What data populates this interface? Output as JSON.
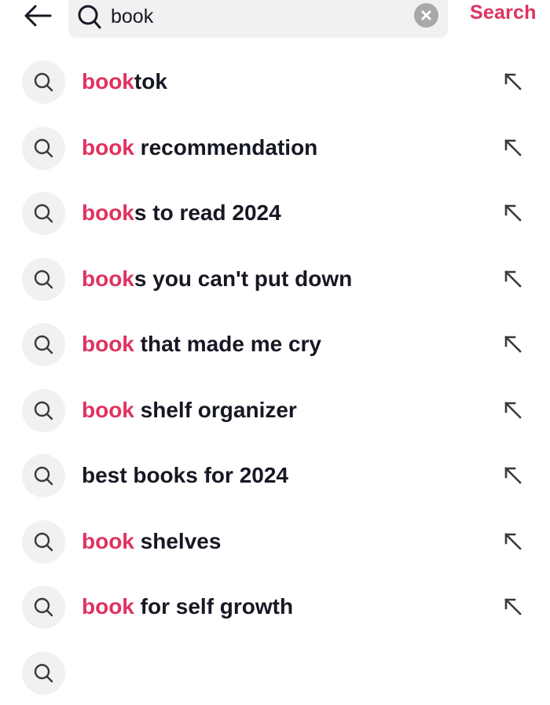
{
  "header": {
    "back_icon": "arrow-left-icon",
    "search_icon": "search-icon",
    "query": "book",
    "clear_icon": "clear-x-icon",
    "search_button_label": "Search"
  },
  "colors": {
    "accent": "#e0325f",
    "text": "#161823",
    "chip_bg": "#f1f1f2",
    "clear_bg": "#a8a8aa"
  },
  "suggestions": [
    {
      "highlight": "book",
      "rest": "tok",
      "icon": "search-icon",
      "action_icon": "fill-query-arrow-icon"
    },
    {
      "highlight": "book",
      "rest": " recommendation",
      "icon": "search-icon",
      "action_icon": "fill-query-arrow-icon"
    },
    {
      "highlight": "book",
      "rest": "s to read 2024",
      "icon": "search-icon",
      "action_icon": "fill-query-arrow-icon"
    },
    {
      "highlight": "book",
      "rest": "s you can't put down",
      "icon": "search-icon",
      "action_icon": "fill-query-arrow-icon"
    },
    {
      "highlight": "book",
      "rest": " that made me cry",
      "icon": "search-icon",
      "action_icon": "fill-query-arrow-icon"
    },
    {
      "highlight": "book",
      "rest": " shelf organizer",
      "icon": "search-icon",
      "action_icon": "fill-query-arrow-icon"
    },
    {
      "highlight": "",
      "rest": "best books for 2024",
      "icon": "search-icon",
      "action_icon": "fill-query-arrow-icon"
    },
    {
      "highlight": "book",
      "rest": " shelves",
      "icon": "search-icon",
      "action_icon": "fill-query-arrow-icon"
    },
    {
      "highlight": "book",
      "rest": " for self growth",
      "icon": "search-icon",
      "action_icon": "fill-query-arrow-icon"
    },
    {
      "highlight": "",
      "rest": "",
      "icon": "search-icon",
      "action_icon": ""
    }
  ]
}
